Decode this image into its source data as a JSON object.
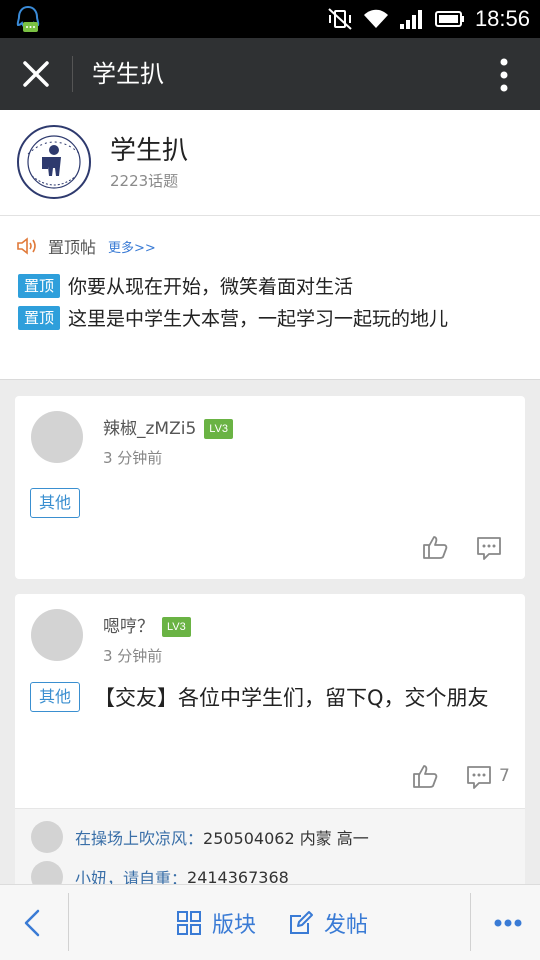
{
  "status_bar": {
    "time": "18:56"
  },
  "title_bar": {
    "title": "学生扒"
  },
  "group": {
    "name": "学生扒",
    "topic_count": "2223话题"
  },
  "pinned": {
    "label": "置顶帖",
    "more": "更多>>",
    "items": [
      {
        "tag": "置顶",
        "text": "你要从现在开始，微笑着面对生活"
      },
      {
        "tag": "置顶",
        "text": "这里是中学生大本营，一起学习一起玩的地儿"
      }
    ]
  },
  "posts": [
    {
      "user": "辣椒_zMZi5",
      "level": "LV3",
      "time": "3 分钟前",
      "tag": "其他",
      "content": "",
      "comment_count": ""
    },
    {
      "user": "嗯哼？",
      "level": "LV3",
      "time": "3 分钟前",
      "tag": "其他",
      "content": "【交友】各位中学生们，留下Q，交个朋友",
      "comment_count": "7",
      "comments": [
        {
          "name": "在操场上吹凉风：",
          "text": "250504062 内蒙 高一"
        },
        {
          "name": "小妞，请自重：",
          "text": "2414367368"
        }
      ]
    }
  ],
  "bottom_bar": {
    "sections": "版块",
    "post": "发帖"
  }
}
